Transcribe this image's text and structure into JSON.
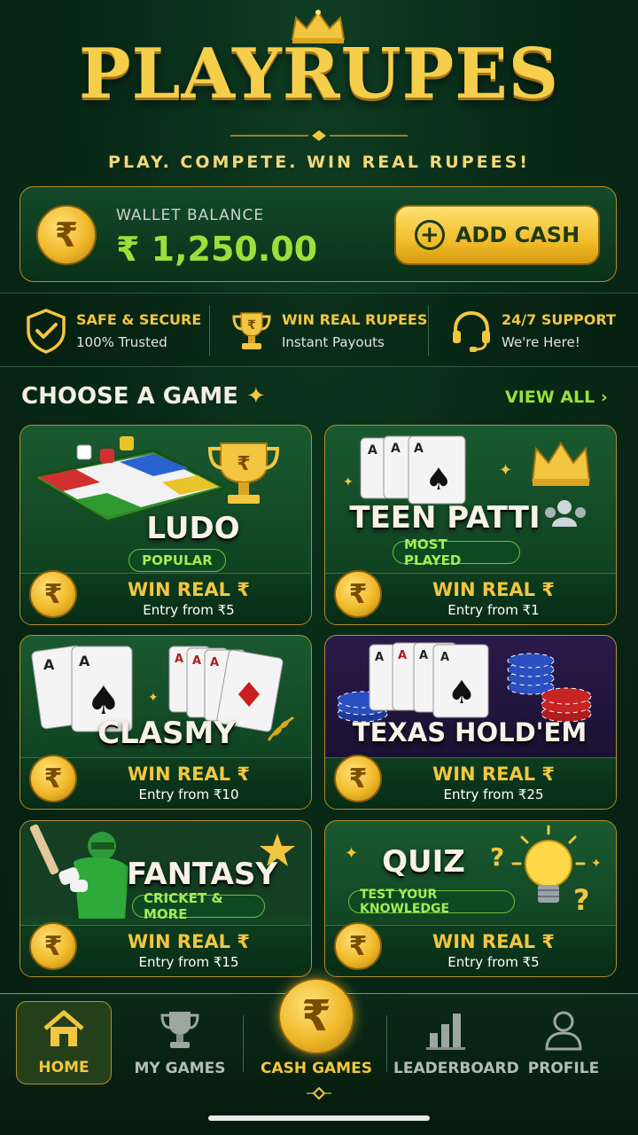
{
  "header": {
    "logo": "PLAYRUPES",
    "tagline": "PLAY. COMPETE. WIN REAL RUPEES!"
  },
  "wallet": {
    "currency_symbol": "₹",
    "label": "WALLET BALANCE",
    "amount": "₹ 1,250.00",
    "add_cash_label": "ADD CASH"
  },
  "features": [
    {
      "title": "SAFE & SECURE",
      "subtitle": "100% Trusted",
      "icon": "shield-check-icon"
    },
    {
      "title": "WIN REAL RUPEES",
      "subtitle": "Instant Payouts",
      "icon": "trophy-icon"
    },
    {
      "title": "24/7 SUPPORT",
      "subtitle": "We're Here!",
      "icon": "headset-icon"
    }
  ],
  "section": {
    "title": "CHOOSE A GAME",
    "view_all": "VIEW ALL"
  },
  "games": [
    {
      "name": "LUDO",
      "badge": "POPULAR",
      "win": "WIN REAL ₹",
      "entry": "Entry from ₹5"
    },
    {
      "name": "TEEN PATTI",
      "badge": "MOST PLAYED",
      "win": "WIN REAL ₹",
      "entry": "Entry from ₹1"
    },
    {
      "name": "CLASMY",
      "badge": "",
      "win": "WIN REAL ₹",
      "entry": "Entry from ₹10"
    },
    {
      "name": "TEXAS HOLD'EM",
      "badge": "",
      "win": "WIN REAL ₹",
      "entry": "Entry from ₹25"
    },
    {
      "name": "FANTASY",
      "badge": "CRICKET & MORE",
      "win": "WIN REAL ₹",
      "entry": "Entry from ₹15"
    },
    {
      "name": "QUIZ",
      "badge": "TEST YOUR KNOWLEDGE",
      "win": "WIN REAL ₹",
      "entry": "Entry from ₹5"
    }
  ],
  "nav": [
    {
      "label": "HOME",
      "icon": "home-icon",
      "active": true
    },
    {
      "label": "MY GAMES",
      "icon": "trophy-icon"
    },
    {
      "label": "CASH GAMES",
      "icon": "rupee-coin-icon"
    },
    {
      "label": "LEADERBOARD",
      "icon": "bar-chart-icon"
    },
    {
      "label": "PROFILE",
      "icon": "user-icon"
    }
  ],
  "colors": {
    "background": "#082a17",
    "gold": "#f3c640",
    "accent_green": "#9be03a"
  }
}
